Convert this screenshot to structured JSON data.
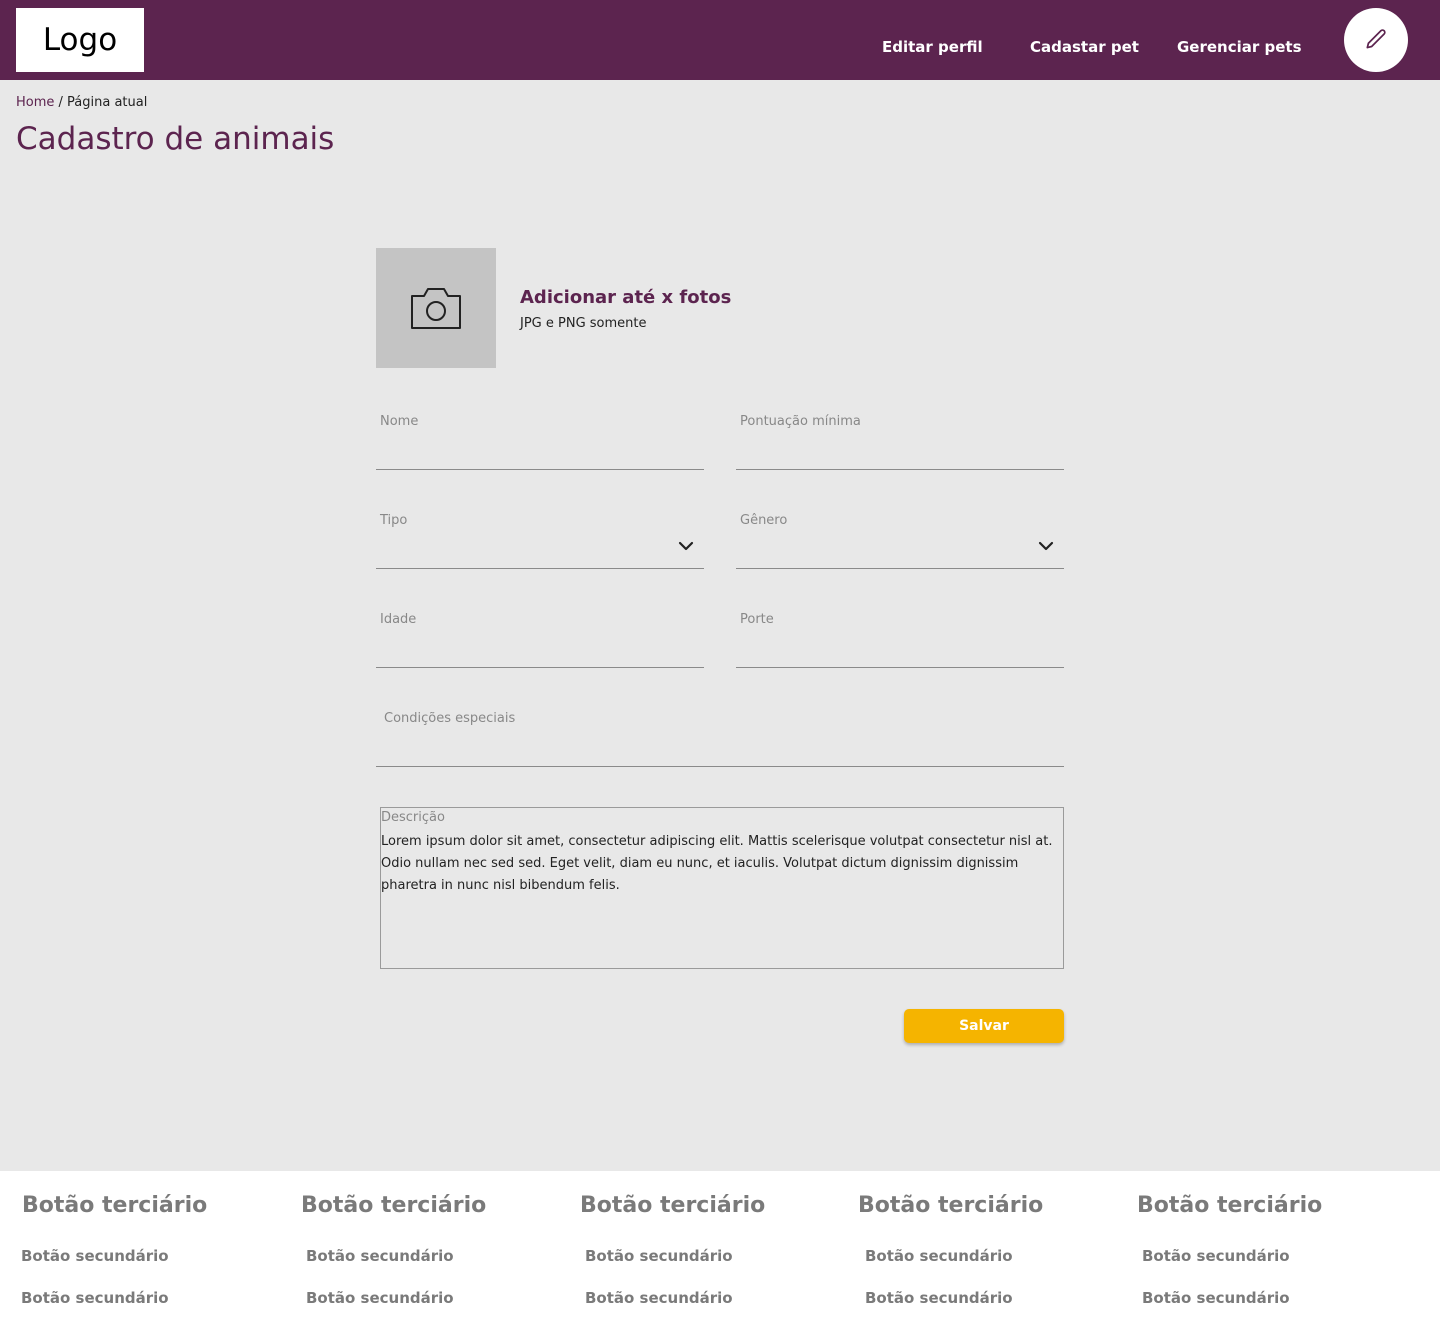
{
  "header": {
    "logo": "Logo",
    "nav": [
      "Editar perfil",
      "Cadastar pet",
      "Gerenciar pets"
    ],
    "edit_icon": "pencil-icon",
    "color": "#5c244f"
  },
  "breadcrumb": {
    "home": "Home",
    "separator": " / ",
    "current": "Página atual"
  },
  "page_title": "Cadastro de animais",
  "photo": {
    "title": "Adicionar até x fotos",
    "subtitle": "JPG e PNG somente",
    "icon": "camera-icon"
  },
  "form": {
    "nome": "Nome",
    "pontuacao": "Pontuação mínima",
    "tipo": "Tipo",
    "genero": "Gênero",
    "idade": "Idade",
    "porte": "Porte",
    "condicoes": "Condições especiais",
    "descricao_label": "Descrição",
    "descricao_value": "Lorem ipsum dolor sit amet, consectetur adipiscing elit. Mattis scelerisque volutpat consectetur nisl at. Odio nullam nec sed sed. Eget velit, diam eu nunc, et iaculis. Volutpat dictum dignissim dignissim pharetra in nunc nisl bibendum felis.",
    "save": "Salvar",
    "save_color": "#f5b400"
  },
  "footer": {
    "columns": [
      {
        "title": "Botão terciário",
        "links": [
          "Botão secundário",
          "Botão secundário"
        ]
      },
      {
        "title": "Botão terciário",
        "links": [
          "Botão secundário",
          "Botão secundário"
        ]
      },
      {
        "title": "Botão terciário",
        "links": [
          "Botão secundário",
          "Botão secundário"
        ]
      },
      {
        "title": "Botão terciário",
        "links": [
          "Botão secundário",
          "Botão secundário"
        ]
      },
      {
        "title": "Botão terciário",
        "links": [
          "Botão secundário",
          "Botão secundário"
        ]
      }
    ]
  }
}
